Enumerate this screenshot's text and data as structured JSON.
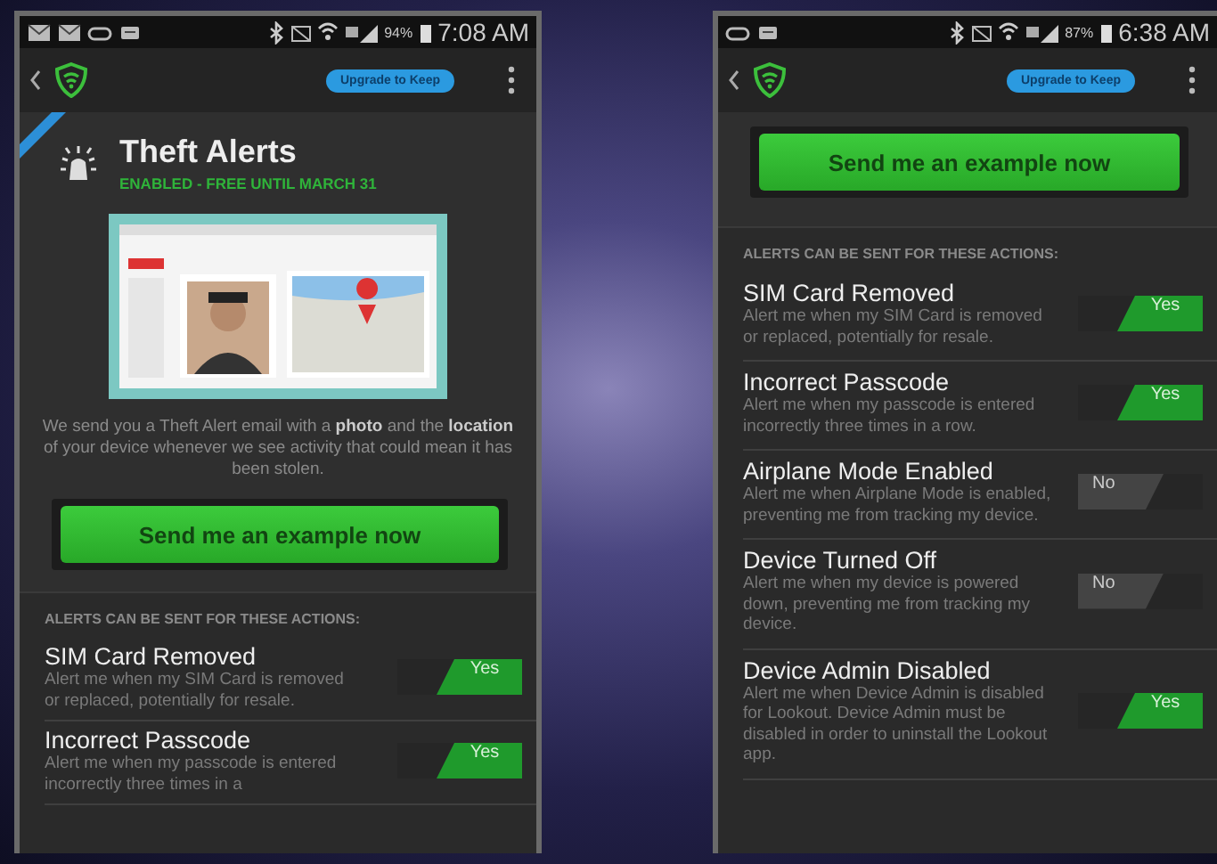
{
  "phones": [
    {
      "status_bar": {
        "notification_icons": [
          {
            "kind": "mail"
          },
          {
            "kind": "mail"
          },
          {
            "kind": "pill"
          },
          {
            "kind": "keyboard"
          }
        ],
        "battery": "94%",
        "time": "7:08 AM"
      },
      "app_bar": {
        "upgrade_button": "Upgrade to Keep"
      },
      "header": {
        "title": "Theft Alerts",
        "subtitle": "ENABLED - FREE UNTIL MARCH 31"
      },
      "description": "We send you a Theft Alert email with a **photo** and the **location** of your device whenever we see activity that could mean it has been stolen.",
      "example_button": "Send me an example now",
      "section_label": "ALERTS CAN BE SENT FOR THESE ACTIONS:",
      "alerts": [
        {
          "title": "SIM Card Removed",
          "description": "Alert me when my SIM Card is removed or replaced, potentially for resale.",
          "on": true,
          "toggle_label": "Yes"
        },
        {
          "title": "Incorrect Passcode",
          "description": "Alert me when my passcode is entered incorrectly three times in a",
          "on": true,
          "toggle_label": "Yes"
        }
      ]
    },
    {
      "status_bar": {
        "notification_icons": [
          {
            "kind": "pill"
          },
          {
            "kind": "keyboard"
          }
        ],
        "battery": "87%",
        "time": "6:38 AM"
      },
      "app_bar": {
        "upgrade_button": "Upgrade to Keep"
      },
      "example_button": "Send me an example now",
      "section_label": "ALERTS CAN BE SENT FOR THESE ACTIONS:",
      "alerts": [
        {
          "title": "SIM Card Removed",
          "description": "Alert me when my SIM Card is removed or replaced, potentially for resale.",
          "on": true,
          "toggle_label": "Yes"
        },
        {
          "title": "Incorrect Passcode",
          "description": "Alert me when my passcode is entered incorrectly three times in a row.",
          "on": true,
          "toggle_label": "Yes"
        },
        {
          "title": "Airplane Mode Enabled",
          "description": "Alert me when Airplane Mode is enabled, preventing me from tracking my device.",
          "on": false,
          "toggle_label": "No"
        },
        {
          "title": "Device Turned Off",
          "description": "Alert me when my device is powered down, preventing me from tracking my device.",
          "on": false,
          "toggle_label": "No"
        },
        {
          "title": "Device Admin Disabled",
          "description": "Alert me when Device Admin is disabled for Lookout. Device Admin must be disabled in order to uninstall the Lookout app.",
          "on": true,
          "toggle_label": "Yes"
        }
      ]
    }
  ]
}
